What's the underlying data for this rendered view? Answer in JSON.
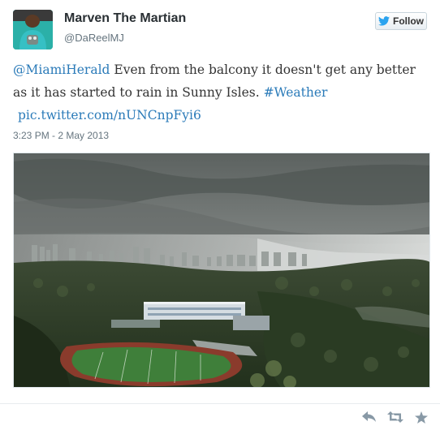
{
  "user": {
    "display_name": "Marven The Martian",
    "handle": "@DaReelMJ",
    "avatar_icon": "avatar-image"
  },
  "follow_button": {
    "label": "Follow",
    "icon": "twitter-bird-icon"
  },
  "tweet": {
    "mention": "@MiamiHerald",
    "body": " Even from the balcony it doesn't get any better as it has started to rain in Sunny Isles. ",
    "hashtag": "#Weather",
    "pic_link": "pic.twitter.com/nUNCnpFyi6",
    "timestamp": "3:23 PM - 2 May 2013"
  },
  "media": {
    "alt_icon": "storm-over-skyline-photo"
  },
  "actions": [
    {
      "icon": "reply-icon"
    },
    {
      "icon": "retweet-icon"
    },
    {
      "icon": "favorite-star-icon"
    }
  ],
  "colors": {
    "link": "#2b7bb9",
    "name": "#292f33",
    "meta": "#66757f",
    "action_icon": "#8899a6"
  }
}
